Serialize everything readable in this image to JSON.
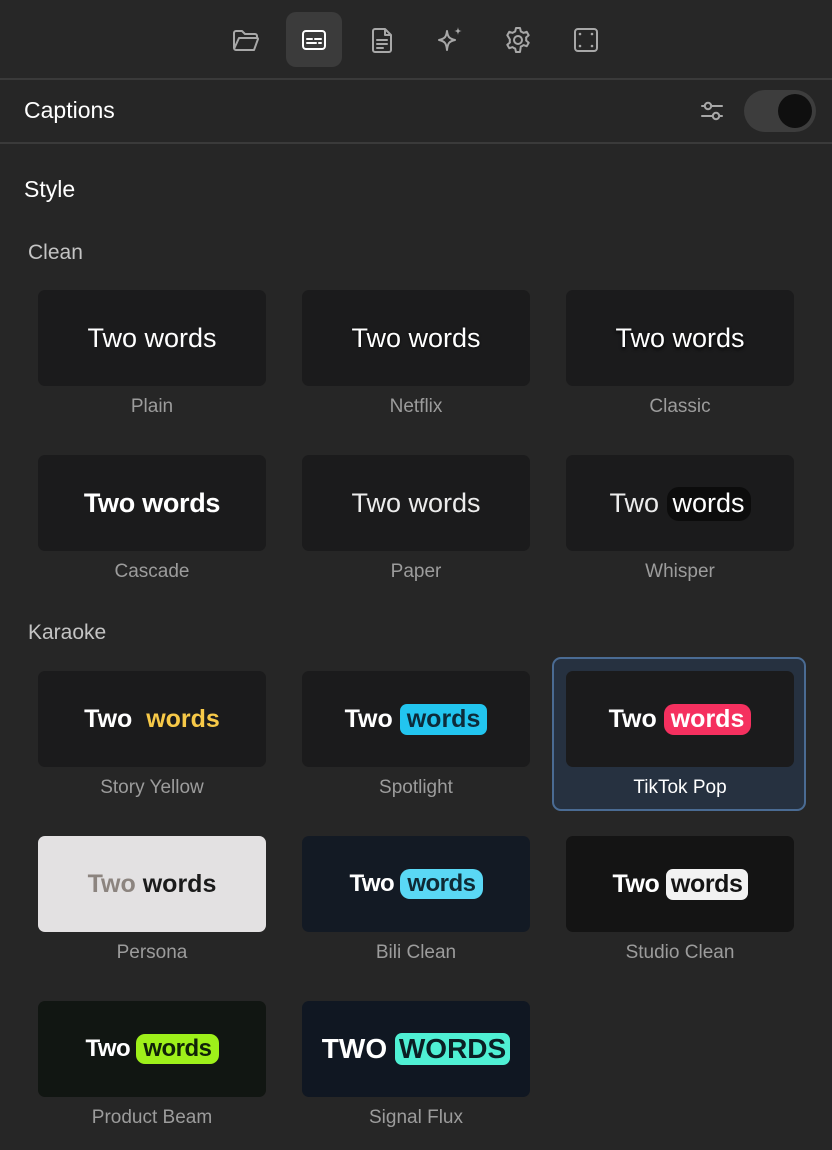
{
  "toolbar": {
    "icons": [
      "folder-icon",
      "captions-icon",
      "document-icon",
      "sparkles-icon",
      "gear-icon",
      "frame-icon"
    ],
    "active": "captions-icon"
  },
  "header": {
    "title": "Captions"
  },
  "style": {
    "title": "Style",
    "groups": {
      "clean": "Clean",
      "karaoke": "Karaoke"
    },
    "preview": {
      "first": "Two",
      "second": "words",
      "first_upper": "TWO",
      "second_upper": "WORDS"
    },
    "styles": {
      "plain": "Plain",
      "netflix": "Netflix",
      "classic": "Classic",
      "cascade": "Cascade",
      "paper": "Paper",
      "whisper": "Whisper",
      "story_yellow": "Story Yellow",
      "spotlight": "Spotlight",
      "tiktok_pop": "TikTok Pop",
      "persona": "Persona",
      "bili_clean": "Bili Clean",
      "studio_clean": "Studio Clean",
      "product_beam": "Product Beam",
      "signal_flux": "Signal Flux"
    },
    "selected": "TikTok Pop"
  },
  "colors": {
    "background": "#262626",
    "card": "#1b1b1c",
    "selected_border": "#4a6b93",
    "story_yellow": "#f7c948",
    "spotlight_cyan": "#22c5ef",
    "tiktok_pink": "#f5305f",
    "bili_cyan": "#5ad8f5",
    "product_green": "#9ef01a",
    "signal_teal": "#4ff0d4"
  }
}
